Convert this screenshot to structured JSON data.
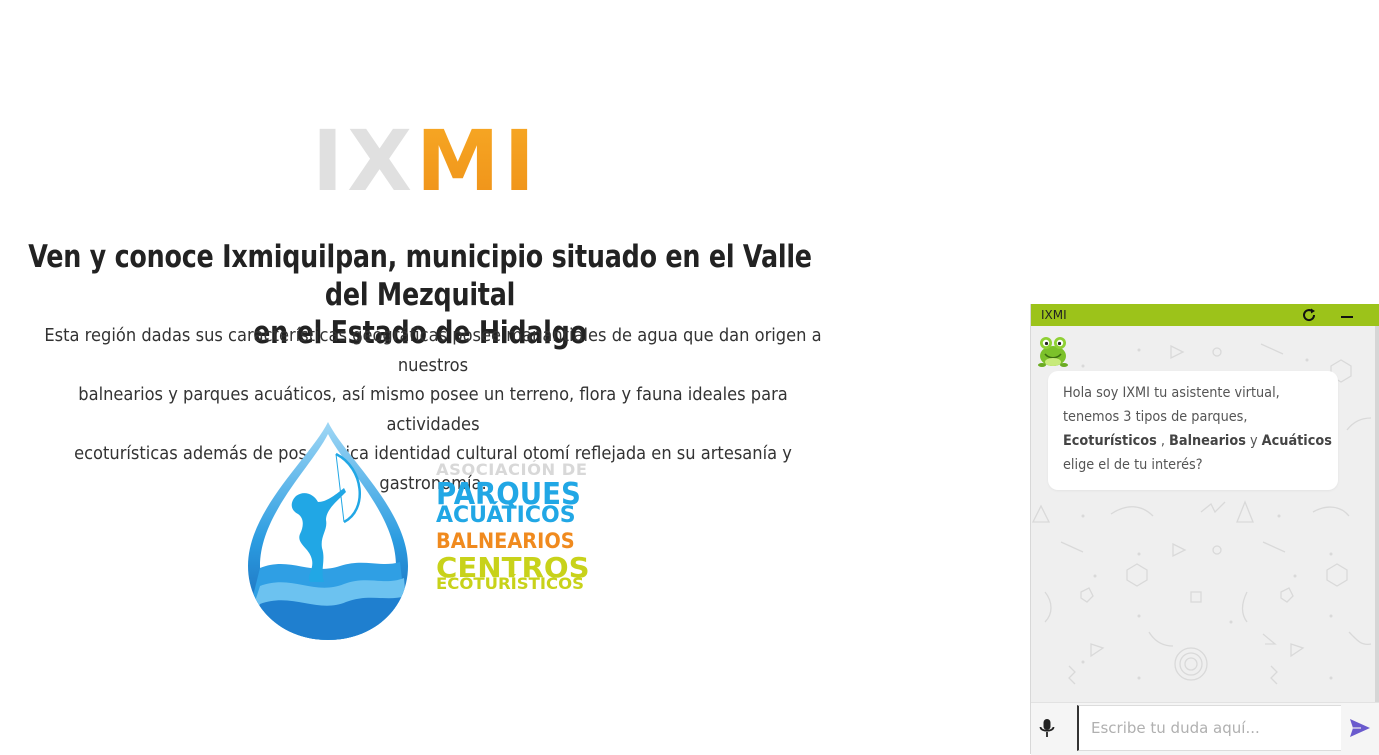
{
  "brand": {
    "logo_grey": "IX",
    "logo_orange": "MI"
  },
  "main": {
    "headline_line1": "Ven y conoce Ixmiquilpan, municipio situado en el Valle del Mezquital",
    "headline_line2": "en el Estado de Hidalgo",
    "lead_line1": "Esta región dadas sus características geográficas posee manantiales de agua que dan origen a nuestros",
    "lead_line2": "balnearios y parques acuáticos, así mismo posee un terreno, flora y fauna ideales para actividades",
    "lead_line3": "ecoturísticas además de poseer rica identidad cultural otomí reflejada en su artesanía y gastronomía."
  },
  "association_logo": {
    "line1": "ASOCIACIÓN DE",
    "line2": "PARQUES",
    "line3": "ACUÁTICOS",
    "line4": "BALNEARIOS",
    "line5": "CENTROS",
    "line6": "ECOTURÍSTICOS"
  },
  "chat": {
    "title": "IXMI",
    "refresh_icon": "refresh-icon",
    "minimize_icon": "minimize-icon",
    "avatar_icon": "frog-avatar-icon",
    "message": {
      "line1": "Hola soy IXMI tu asistente virtual,",
      "line2": "tenemos 3 tipos de parques,",
      "opt1": "Ecoturísticos",
      "sep1": " , ",
      "opt2": "Balnearios",
      "sep2": " y ",
      "opt3": "Acuáticos",
      "line4": "elige el de tu interés?"
    },
    "input_placeholder": "Escribe tu duda aquí...",
    "input_value": "",
    "mic_icon": "microphone-icon",
    "send_icon": "send-icon"
  },
  "colors": {
    "header_green": "#9cc31a",
    "logo_orange": "#f39c1f",
    "logo_grey": "#e0e0e0",
    "blue": "#21a7e5",
    "send_purple": "#6a5acd"
  }
}
